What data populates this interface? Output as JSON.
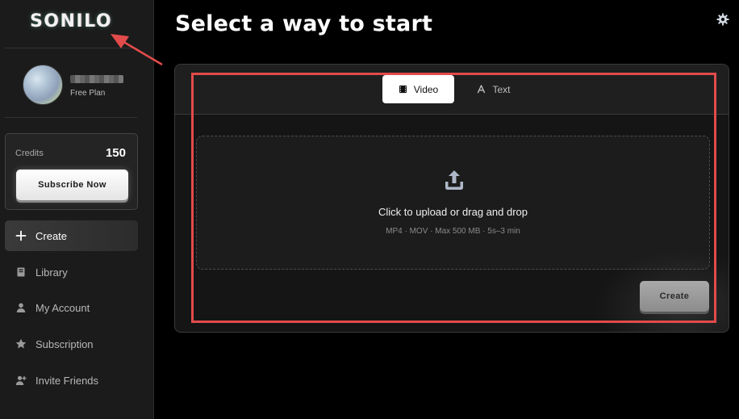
{
  "brand": {
    "logo_text": "SONILO"
  },
  "profile": {
    "plan": "Free Plan"
  },
  "credits": {
    "label": "Credits",
    "value": "150",
    "subscribe_label": "Subscribe Now"
  },
  "sidebar": {
    "items": [
      {
        "label": "Create",
        "icon": "plus-icon",
        "active": true
      },
      {
        "label": "Library",
        "icon": "book-icon"
      },
      {
        "label": "My Account",
        "icon": "user-icon"
      },
      {
        "label": "Subscription",
        "icon": "star-icon"
      },
      {
        "label": "Invite Friends",
        "icon": "user-plus-icon"
      }
    ]
  },
  "main": {
    "title": "Select a way to start",
    "tabs": [
      {
        "label": "Video",
        "icon": "film-icon",
        "selected": true
      },
      {
        "label": "Text",
        "icon": "text-icon"
      }
    ],
    "upload": {
      "title": "Click to upload or drag and drop",
      "hint": "MP4 · MOV · Max 500 MB · 5s–3 min",
      "icon": "upload-icon"
    },
    "create_label": "Create",
    "settings_icon": "gear-icon"
  },
  "colors": {
    "background": "#000000",
    "sidebar": "#1b1b1b",
    "annotation": "#e24b4b"
  }
}
